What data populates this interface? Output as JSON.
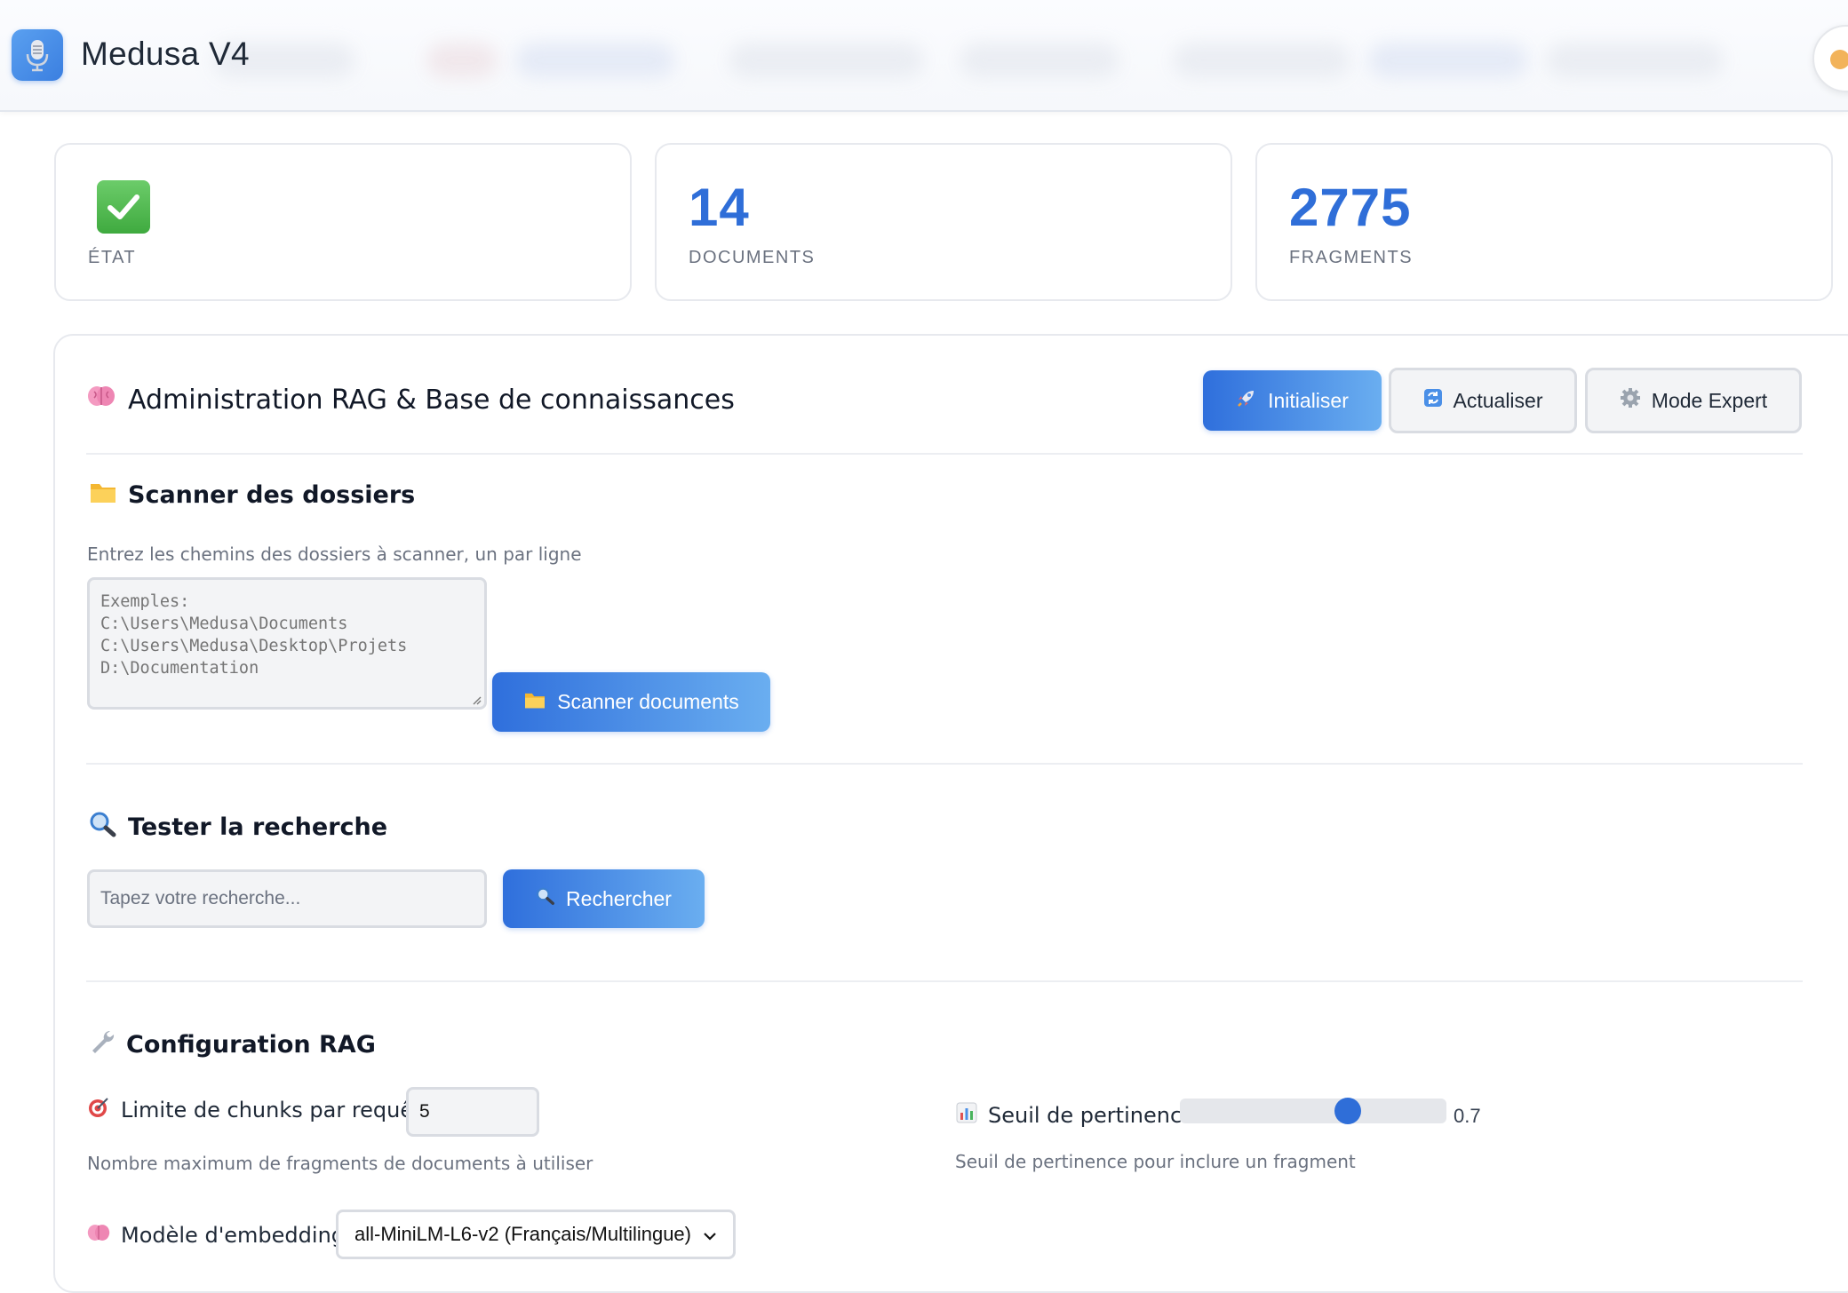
{
  "app": {
    "title": "Medusa V4"
  },
  "stats": [
    {
      "value": "",
      "label": "ÉTAT",
      "icon": "check-icon"
    },
    {
      "value": "14",
      "label": "DOCUMENTS"
    },
    {
      "value": "2775",
      "label": "FRAGMENTS"
    }
  ],
  "panel": {
    "title": "Administration RAG & Base de connaissances",
    "title_icon": "brain-icon",
    "buttons": {
      "init": "Initialiser",
      "refresh": "Actualiser",
      "expert": "Mode Expert"
    }
  },
  "scan": {
    "title": "Scanner des dossiers",
    "help": "Entrez les chemins des dossiers à scanner, un par ligne",
    "placeholder": "Exemples:\nC:\\Users\\Medusa\\Documents\nC:\\Users\\Medusa\\Desktop\\Projets\nD:\\Documentation",
    "button": "Scanner documents"
  },
  "search": {
    "title": "Tester la recherche",
    "placeholder": "Tapez votre recherche...",
    "button": "Rechercher"
  },
  "config": {
    "title": "Configuration RAG",
    "chunk_label": "Limite de chunks par requête:",
    "chunk_value": "5",
    "chunk_help": "Nombre maximum de fragments de documents à utiliser",
    "threshold_label": "Seuil de pertinence:",
    "threshold_value": "0.7",
    "threshold_fraction": 0.63,
    "threshold_help": "Seuil de pertinence pour inclure un fragment",
    "embedding_label": "Modèle d'embedding:",
    "embedding_value": "all-MiniLM-L6-v2 (Français/Multilingue)"
  },
  "colors": {
    "accent": "#2f6ed8",
    "accent_light": "#6aaef0",
    "border": "#d9dce2",
    "muted_text": "#6b7280"
  }
}
